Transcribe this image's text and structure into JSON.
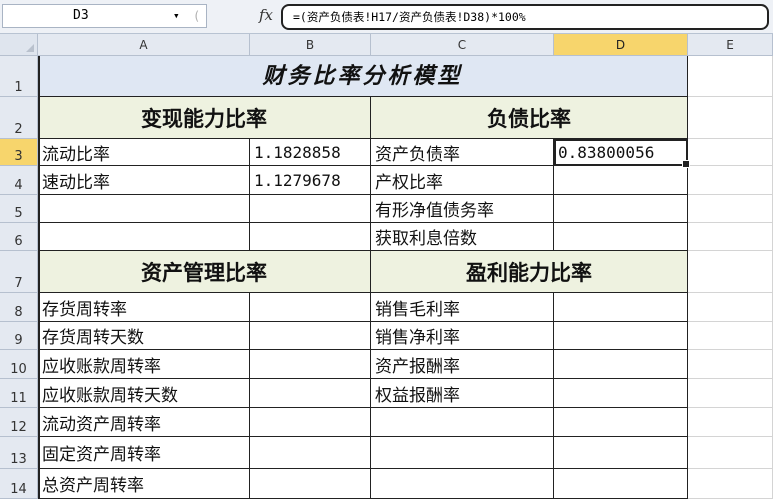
{
  "formula_bar": {
    "name_box": "D3",
    "fx_label": "fx",
    "formula": "=(资产负债表!H17/资产负债表!D38)*100%"
  },
  "columns": [
    "A",
    "B",
    "C",
    "D",
    "E"
  ],
  "rows": [
    "1",
    "2",
    "3",
    "4",
    "5",
    "6",
    "7",
    "8",
    "9",
    "10",
    "11",
    "12",
    "13",
    "14"
  ],
  "sheet": {
    "title": "财务比率分析模型",
    "sections": {
      "liquidity": "变现能力比率",
      "debt": "负债比率",
      "asset_management": "资产管理比率",
      "profitability": "盈利能力比率"
    },
    "left_items": {
      "r3": "流动比率",
      "r4": "速动比率",
      "r8": "存货周转率",
      "r9": "存货周转天数",
      "r10": "应收账款周转率",
      "r11": "应收账款周转天数",
      "r12": "流动资产周转率",
      "r13": "固定资产周转率",
      "r14": "总资产周转率"
    },
    "left_values": {
      "r3": "1.1828858",
      "r4": "1.1279678"
    },
    "right_items": {
      "r3": "资产负债率",
      "r4": "产权比率",
      "r5": "有形净值债务率",
      "r6": "获取利息倍数",
      "r8": "销售毛利率",
      "r9": "销售净利率",
      "r10": "资产报酬率",
      "r11": "权益报酬率"
    },
    "right_values": {
      "r3": "0.83800056"
    }
  },
  "active_cell": "D3",
  "colors": {
    "title_fill": "#dfe7f3",
    "section_fill": "#eef2e0",
    "active_header": "#f7d56c"
  }
}
